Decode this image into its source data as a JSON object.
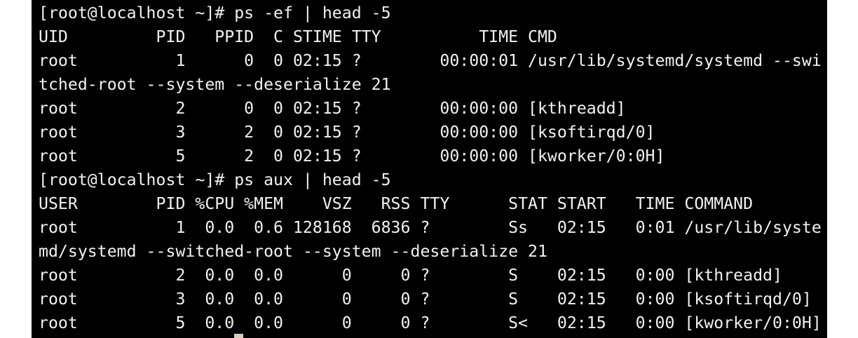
{
  "terminal": {
    "lines": [
      "[root@localhost ~]# ps -ef | head -5",
      "UID         PID   PPID  C STIME TTY          TIME CMD",
      "root          1      0  0 02:15 ?        00:00:01 /usr/lib/systemd/systemd --swi",
      "tched-root --system --deserialize 21",
      "root          2      0  0 02:15 ?        00:00:00 [kthreadd]",
      "root          3      2  0 02:15 ?        00:00:00 [ksoftirqd/0]",
      "root          5      2  0 02:15 ?        00:00:00 [kworker/0:0H]",
      "[root@localhost ~]# ps aux | head -5",
      "USER        PID %CPU %MEM    VSZ   RSS TTY      STAT START   TIME COMMAND",
      "root          1  0.0  0.6 128168  6836 ?        Ss   02:15   0:01 /usr/lib/syste",
      "md/systemd --switched-root --system --deserialize 21",
      "root          2  0.0  0.0      0     0 ?        S    02:15   0:00 [kthreadd]",
      "root          3  0.0  0.0      0     0 ?        S    02:15   0:00 [ksoftirqd/0]",
      "root          5  0.0  0.0      0     0 ?        S<   02:15   0:00 [kworker/0:0H]"
    ]
  },
  "colors": {
    "background": "#000000",
    "foreground": "#f2f2f2",
    "cursor": "#d9cdbd"
  }
}
